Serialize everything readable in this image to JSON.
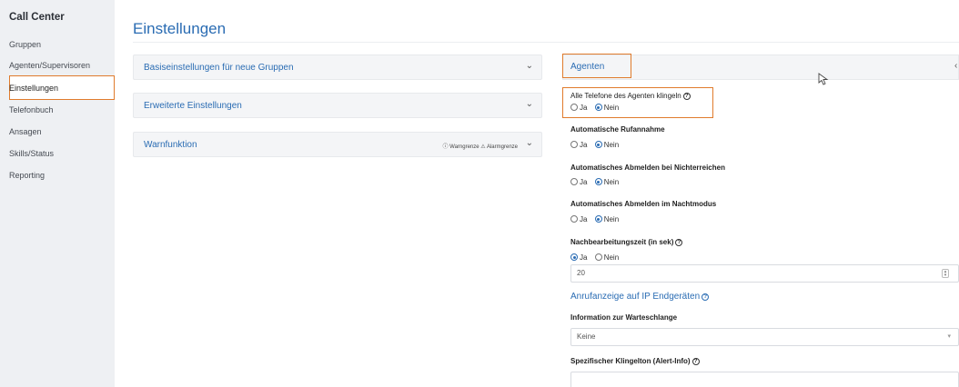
{
  "sidebar": {
    "title": "Call Center",
    "items": [
      {
        "label": "Gruppen"
      },
      {
        "label": "Agenten/Supervisoren"
      },
      {
        "label": "Einstellungen"
      },
      {
        "label": "Telefonbuch"
      },
      {
        "label": "Ansagen"
      },
      {
        "label": "Skills/Status"
      },
      {
        "label": "Reporting"
      }
    ],
    "active": "Einstellungen"
  },
  "page": {
    "title": "Einstellungen"
  },
  "left_panels": [
    {
      "label": "Basiseinstellungen für neue Gruppen"
    },
    {
      "label": "Erweiterte Einstellungen"
    },
    {
      "label": "Warnfunktion",
      "legend": "ⓘ Warngrenze ⚠ Alarmgrenze"
    }
  ],
  "agenten": {
    "label": "Agenten",
    "settings": [
      {
        "label": "Alle Telefone des Agenten klingeln",
        "help": "?",
        "options": [
          "Ja",
          "Nein"
        ],
        "selected": "Nein"
      },
      {
        "label": "Automatische Rufannahme",
        "options": [
          "Ja",
          "Nein"
        ],
        "selected": "Nein"
      },
      {
        "label": "Automatisches Abmelden bei Nichterreichen",
        "options": [
          "Ja",
          "Nein"
        ],
        "selected": "Nein"
      },
      {
        "label": "Automatisches Abmelden im Nachtmodus",
        "options": [
          "Ja",
          "Nein"
        ],
        "selected": "Nein"
      },
      {
        "label": "Nachbearbeitungszeit (in sek)",
        "help": "?",
        "options": [
          "Ja",
          "Nein"
        ],
        "selected": "Ja"
      }
    ],
    "nachbearbeitung_value": "20",
    "anrufanzeige_link": "Anrufanzeige auf IP Endgeräten",
    "warteschlange": {
      "label": "Information zur Warteschlange",
      "value": "Keine"
    },
    "klingelton": {
      "label": "Spezifischer Klingelton (Alert-Info)",
      "value": ""
    }
  },
  "colors": {
    "accent": "#2a6cb3",
    "highlight": "#e07b2c",
    "sidebar_bg": "#eef0f3"
  }
}
